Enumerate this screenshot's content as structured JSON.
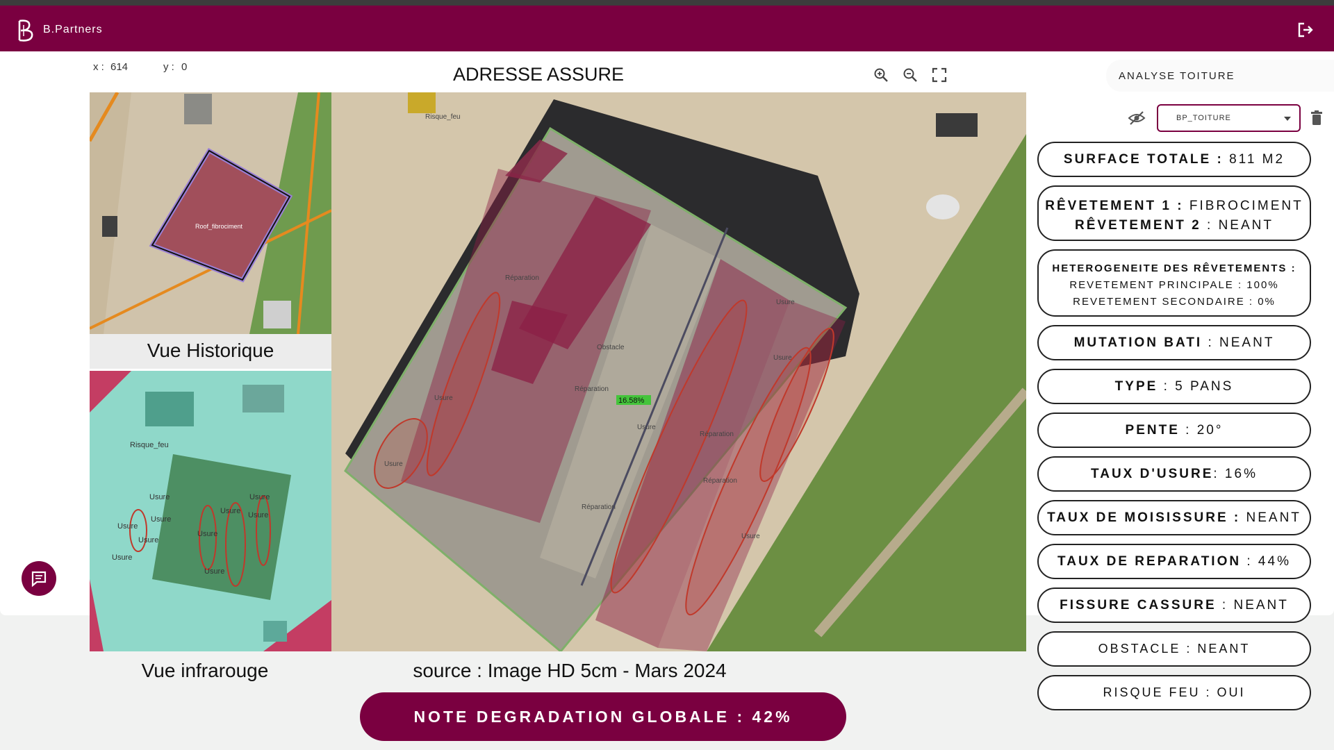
{
  "header": {
    "brand": "B.Partners"
  },
  "viewer": {
    "coord_x_label": "x :",
    "coord_x": "614",
    "coord_y_label": "y :",
    "coord_y": "0",
    "title": "ADRESSE ASSURE",
    "historic_caption": "Vue Historique",
    "infrared_caption": "Vue infrarouge",
    "source": "source : Image HD 5cm - Mars 2024",
    "historic_roof_label": "Roof_fibrociment",
    "main_percentage": "16.58%",
    "main_labels": [
      "Risque_feu",
      "Réparation",
      "Usure",
      "Usure",
      "Obstacle",
      "Réparation",
      "Réparation",
      "Usure",
      "Usure",
      "Usure",
      "Réparation",
      "Réparation",
      "Usure"
    ],
    "ir_labels": [
      "Risque_feu",
      "Usure",
      "Usure",
      "Usure",
      "Usure",
      "Usure",
      "Usure",
      "Usure",
      "Usure",
      "Usure",
      "Usure"
    ]
  },
  "note": {
    "label": "NOTE DEGRADATION GLOBALE : 42%"
  },
  "panel": {
    "title": "ANALYSE TOITURE",
    "select_value": "BP_TOITURE",
    "metrics": [
      {
        "key": "SURFACE TOTALE :",
        "value": " 811 M2"
      },
      {
        "key": "RÊVETEMENT 1 :",
        "value": " FIBROCIMENT"
      },
      {
        "key": "RÊVETEMENT 2",
        "value": " : NEANT"
      },
      {
        "key": "HETEROGENEITE DES RÊVETEMENTS :",
        "value": ""
      },
      {
        "key": "",
        "value": "REVETEMENT PRINCIPALE : 100%"
      },
      {
        "key": "",
        "value": "REVETEMENT SECONDAIRE : 0%"
      },
      {
        "key": "MUTATION BATI",
        "value": " : NEANT"
      },
      {
        "key": "TYPE",
        "value": " : 5 PANS"
      },
      {
        "key": "PENTE",
        "value": " : 20°"
      },
      {
        "key": "TAUX D'USURE",
        "value": ": 16%"
      },
      {
        "key": "TAUX DE MOISISSURE :",
        "value": " NEANT"
      },
      {
        "key": "TAUX DE REPARATION",
        "value": " : 44%"
      },
      {
        "key": "FISSURE CASSURE",
        "value": " : NEANT"
      },
      {
        "key": "",
        "value": "OBSTACLE : NEANT"
      },
      {
        "key": "",
        "value": "RISQUE FEU : OUI"
      }
    ]
  },
  "colors": {
    "brand": "#7a0040",
    "roof_overlay": "#8b1f45",
    "damage": "#c0392b"
  }
}
